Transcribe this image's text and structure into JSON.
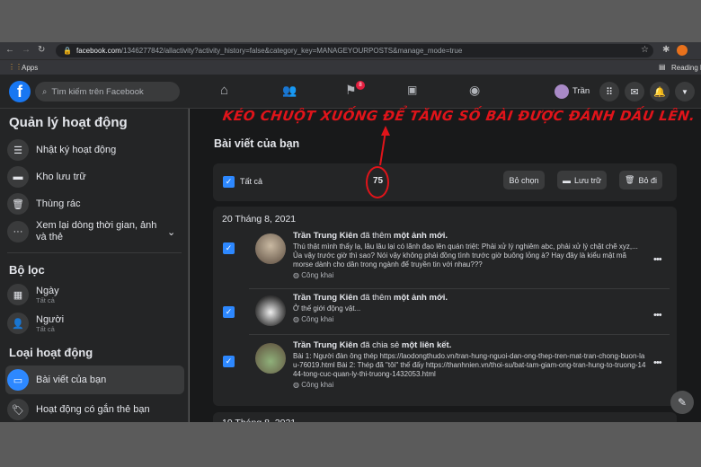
{
  "browser": {
    "url_domain": "facebook.com",
    "url_path": "/1346277842/allactivity?activity_history=false&category_key=MANAGEYOURPOSTS&manage_mode=true",
    "bookmarks_apps": "Apps",
    "reading_list": "Reading lis"
  },
  "header": {
    "search_placeholder": "Tìm kiếm trên Facebook",
    "notification_count": "8",
    "profile_name": "Trần"
  },
  "sidebar": {
    "title": "Quản lý hoạt động",
    "items": [
      {
        "label": "Nhật ký hoạt động"
      },
      {
        "label": "Kho lưu trữ"
      },
      {
        "label": "Thùng rác"
      },
      {
        "label": "Xem lại dòng thời gian, ảnh và thẻ"
      }
    ],
    "filter_title": "Bộ lọc",
    "filters": [
      {
        "label": "Ngày",
        "value": "Tất cả"
      },
      {
        "label": "Người",
        "value": "Tất cả"
      }
    ],
    "type_title": "Loại hoạt động",
    "types": [
      {
        "label": "Bài viết của bạn",
        "active": true
      },
      {
        "label": "Hoạt động có gắn thẻ bạn"
      }
    ]
  },
  "annotation": "KÉO CHUỘT XUỐNG ĐỂ TĂNG SỐ BÀI ĐƯỢC ĐÁNH DẤU LÊN.",
  "main": {
    "title": "Bài viết của bạn",
    "select_all": "Tất cả",
    "selected_count": "75",
    "deselect": "Bỏ chọn",
    "archive": "Lưu trữ",
    "remove": "Bỏ đi",
    "date1": "20 Tháng 8, 2021",
    "date2": "19 Tháng 8, 2021",
    "posts": [
      {
        "author": "Trần Trung Kiên",
        "action": "đã thêm",
        "object": "một ảnh mới.",
        "text": "Thú thật mình thấy lạ, lâu lâu lại có lãnh đạo lên quán triệt: Phải xử lý nghiêm abc, phải xử lý chặt chẽ xyz,... Ủa vậy trước giờ thì sao? Nói vậy không phải đồng tình trước giờ buông lỏng à? Hay đây là kiểu mật mã morse dành cho dân trong ngành để truyền tin với nhau???",
        "privacy": "Công khai"
      },
      {
        "author": "Trần Trung Kiên",
        "action": "đã thêm",
        "object": "một ảnh mới.",
        "text": "Ở thế giới động vật...",
        "privacy": "Công khai"
      },
      {
        "author": "Trần Trung Kiên",
        "action": "đã chia sẻ",
        "object": "một liên kết.",
        "text": "Bài 1: Người đàn ông thép https://laodongthudo.vn/tran-hung-nguoi-dan-ong-thep-tren-mat-tran-chong-buon-lau-76019.html Bài 2: Thép đã \"tôi\" thế đấy https://thanhnien.vn/thoi-su/bat-tam-giam-ong-tran-hung-to-truong-1444-tong-cuc-quan-ly-thi-truong-1432053.html",
        "privacy": "Công khai"
      }
    ]
  },
  "colors": {
    "accent": "#2d88ff",
    "annotation": "#e0141a",
    "bg": "#18191a",
    "card": "#242526"
  }
}
